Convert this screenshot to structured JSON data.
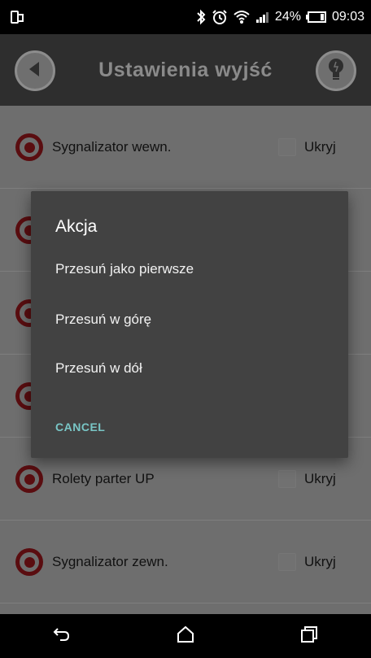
{
  "status_bar": {
    "battery": "24%",
    "time": "09:03",
    "icons": [
      "screen-mirror-icon",
      "bluetooth-icon",
      "alarm-icon",
      "wifi-icon",
      "signal-icon",
      "battery-icon"
    ]
  },
  "header": {
    "title": "Ustawienia wyjść",
    "icons": [
      "back-icon",
      "lightbulb-icon"
    ]
  },
  "list": {
    "rows": [
      {
        "label": "Sygnalizator wewn.",
        "hide_label": "Ukryj"
      },
      {
        "label": "",
        "hide_label": ""
      },
      {
        "label": "",
        "hide_label": ""
      },
      {
        "label": "",
        "hide_label": ""
      },
      {
        "label": "Rolety parter UP",
        "hide_label": "Ukryj"
      },
      {
        "label": "Sygnalizator zewn.",
        "hide_label": "Ukryj"
      }
    ]
  },
  "dialog": {
    "title": "Akcja",
    "items": [
      "Przesuń jako pierwsze",
      "Przesuń w górę",
      "Przesuń w dół"
    ],
    "cancel": "CANCEL"
  },
  "nav_bar": {
    "icons": [
      "back-nav-icon",
      "home-icon",
      "recents-icon"
    ]
  },
  "colors": {
    "accent": "#79c6c6",
    "dialog_bg": "#424242",
    "list_bg": "#6e6e6e",
    "icon_red": "#5a0d10"
  }
}
